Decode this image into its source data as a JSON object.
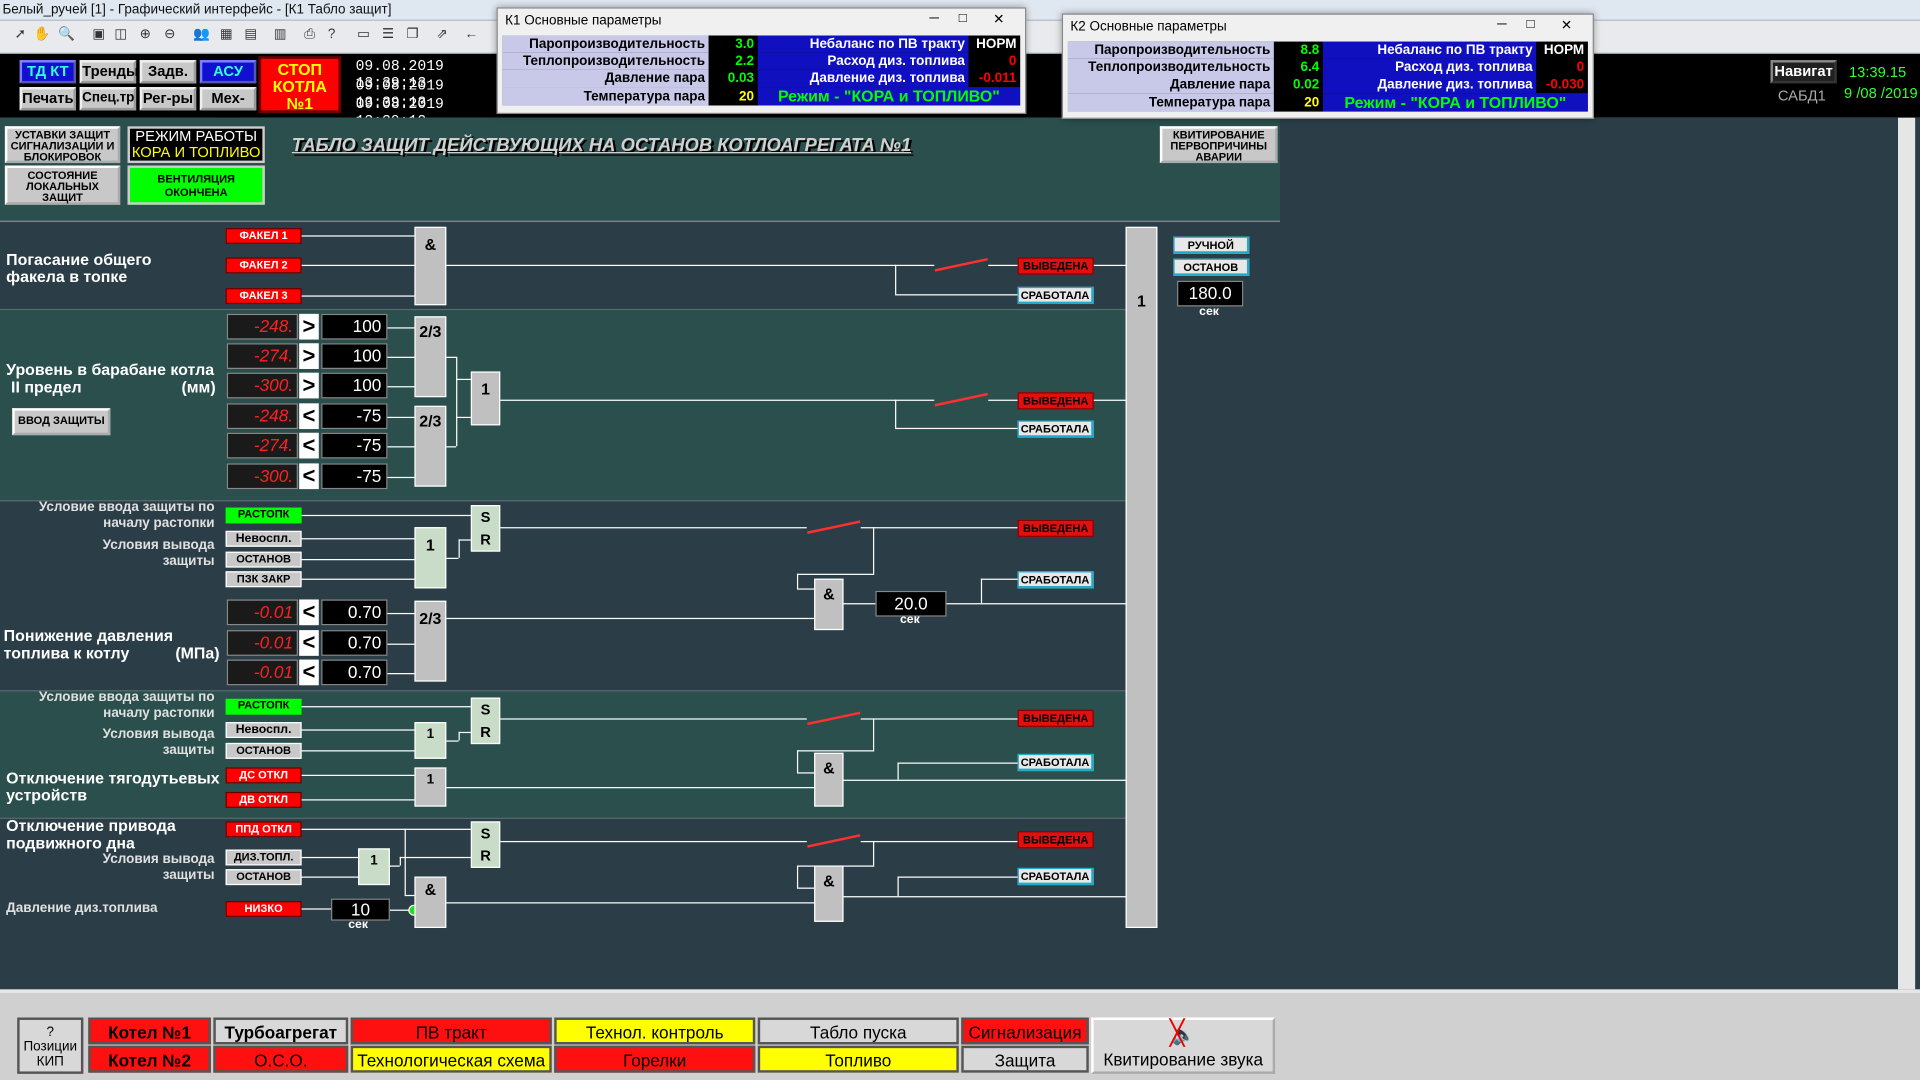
{
  "window_title": "Белый_ручей [1] - Графический интерфейс - [К1 Табло защит]",
  "header": {
    "buttons": [
      {
        "label": "ТД КТ",
        "kind": "blue"
      },
      {
        "label": "Тренды"
      },
      {
        "label": "Задв."
      },
      {
        "label": "АСУ",
        "kind": "blue"
      },
      {
        "label": "Печать"
      },
      {
        "label": "Спец.тр"
      },
      {
        "label": "Рег-ры"
      },
      {
        "label": "Мех-мы"
      }
    ],
    "stop_label": [
      "СТОП",
      "КОТЛА",
      "№1"
    ],
    "datetimes": [
      "09.08.2019 13:39:13",
      "09.08.2019 13:39:13",
      "09.08.2019 13:39:12"
    ],
    "nav_label": "Навигат",
    "sabd": "САБД1",
    "clock_time": "13:39.15",
    "clock_date": "9 /08 /2019"
  },
  "popup_k1": {
    "title": "К1 Основные параметры",
    "rows": [
      {
        "l": "Паропроизводительность",
        "v": "3.0",
        "r": "Небаланс по ПВ тракту",
        "rv": "НОРМ"
      },
      {
        "l": "Теплопроизводительность",
        "v": "2.2",
        "r": "Расход диз. топлива",
        "rv": "0"
      },
      {
        "l": "Давление пара",
        "v": "0.03",
        "r": "Давление диз. топлива",
        "rv": "-0.011"
      },
      {
        "l": "Температура пара",
        "v": "20",
        "r": "Режим - \"КОРА и ТОПЛИВО\"",
        "rv": ""
      }
    ]
  },
  "popup_k2": {
    "title": "К2 Основные параметры",
    "rows": [
      {
        "l": "Паропроизводительность",
        "v": "8.8",
        "r": "Небаланс по ПВ тракту",
        "rv": "НОРМ"
      },
      {
        "l": "Теплопроизводительность",
        "v": "6.4",
        "r": "Расход диз. топлива",
        "rv": "0"
      },
      {
        "l": "Давление пара",
        "v": "0.02",
        "r": "Давление диз. топлива",
        "rv": "-0.030"
      },
      {
        "l": "Температура пара",
        "v": "20",
        "r": "Режим - \"КОРА и ТОПЛИВО\"",
        "rv": ""
      }
    ]
  },
  "top": {
    "setup_btn": "УСТАВКИ ЗАЩИТ СИГНАЛИЗАЦИИ И БЛОКИРОВОК",
    "mode_title": "РЕЖИМ РАБОТЫ",
    "mode_value": "КОРА И ТОПЛИВО",
    "local_btn": "СОСТОЯНИЕ ЛОКАЛЬНЫХ ЗАЩИТ",
    "vent": "ВЕНТИЛЯЦИЯ ОКОНЧЕНА",
    "board_title": "ТАБЛО ЗАЩИТ ДЕЙСТВУЮЩИХ НА ОСТАНОВ КОТЛОАГРЕГАТА №1",
    "ack_btn": "КВИТИРОВАНИЕ ПЕРВОПРИЧИНЫ АВАРИИ"
  },
  "right": {
    "manual": "РУЧНОЙ",
    "stop": "ОСТАНОВ",
    "timer": "180.0",
    "sec": "сек",
    "or_gate": "1"
  },
  "s1": {
    "label": "Погасание общего факела в топке",
    "inputs": [
      "ФАКЕЛ 1",
      "ФАКЕЛ 2",
      "ФАКЕЛ 3"
    ],
    "gate": "&",
    "off": "ВЫВЕДЕНА",
    "trig": "СРАБОТАЛА"
  },
  "s2": {
    "label_a": "Уровень в барабане котла",
    "label_b": "II предел",
    "unit": "(мм)",
    "enter_btn": "ВВОД ЗАЩИТЫ",
    "rows": [
      {
        "v": "-248.",
        "op": ">",
        "s": "100"
      },
      {
        "v": "-274.",
        "op": ">",
        "s": "100"
      },
      {
        "v": "-300.",
        "op": ">",
        "s": "100"
      },
      {
        "v": "-248.",
        "op": "<",
        "s": "-75"
      },
      {
        "v": "-274.",
        "op": "<",
        "s": "-75"
      },
      {
        "v": "-300.",
        "op": "<",
        "s": "-75"
      }
    ],
    "g1": "2/3",
    "g2": "2/3",
    "g3": "1",
    "off": "ВЫВЕДЕНА",
    "trig": "СРАБОТАЛА"
  },
  "s3": {
    "cond_in": "Условие ввода защиты по началу растопки",
    "cond_out": "Условия вывода защиты",
    "label": "Понижение давления топлива к котлу",
    "unit": "(МПа)",
    "start": "РАСТОПК",
    "in": [
      "Невоспл.",
      "ОСТАНОВ",
      "ПЗК ЗАКР"
    ],
    "or": "1",
    "s": "S",
    "r": "R",
    "rows": [
      {
        "v": "-0.01",
        "op": "<",
        "s": "0.70"
      },
      {
        "v": "-0.01",
        "op": "<",
        "s": "0.70"
      },
      {
        "v": "-0.01",
        "op": "<",
        "s": "0.70"
      }
    ],
    "g": "2/3",
    "and": "&",
    "timer": "20.0",
    "sec": "сек",
    "off": "ВЫВЕДЕНА",
    "trig": "СРАБОТАЛА"
  },
  "s4": {
    "cond_in": "Условие ввода защиты по началу растопки",
    "cond_out": "Условия вывода защиты",
    "label": "Отключение тягодутьевых устройств",
    "start": "РАСТОПК",
    "in": [
      "Невоспл.",
      "ОСТАНОВ"
    ],
    "or": "1",
    "dev": [
      "ДС ОТКЛ",
      "ДВ ОТКЛ"
    ],
    "or2": "1",
    "s": "S",
    "r": "R",
    "and": "&",
    "off": "ВЫВЕДЕНА",
    "trig": "СРАБОТАЛА"
  },
  "s5": {
    "label": "Отключение привода подвижного дна",
    "cond_out": "Условия вывода защиты",
    "fuel": "Давление диз.топлива",
    "pd": "ППД ОТКЛ",
    "in": [
      "ДИЗ.ТОПЛ.",
      "ОСТАНОВ"
    ],
    "or": "1",
    "low": "НИЗКО",
    "timer": "10",
    "sec": "сек",
    "and": "&",
    "s": "S",
    "r": "R",
    "and2": "&",
    "off": "ВЫВЕДЕНА",
    "trig": "СРАБОТАЛА"
  },
  "footer": {
    "pos": "Позиции КИП",
    "pos_q": "?",
    "b": {
      "k1": "Котел №1",
      "k2": "Котел №2",
      "turbo": "Турбоагрегат",
      "oso": "О.С.О.",
      "pv": "ПВ тракт",
      "tech": "Технологическая схема",
      "tc": "Технол. контроль",
      "burn": "Горелки",
      "start": "Табло пуска",
      "fuel": "Топливо",
      "sig": "Сигнализация",
      "prot": "Защита",
      "snd": "Квитирование звука"
    }
  }
}
